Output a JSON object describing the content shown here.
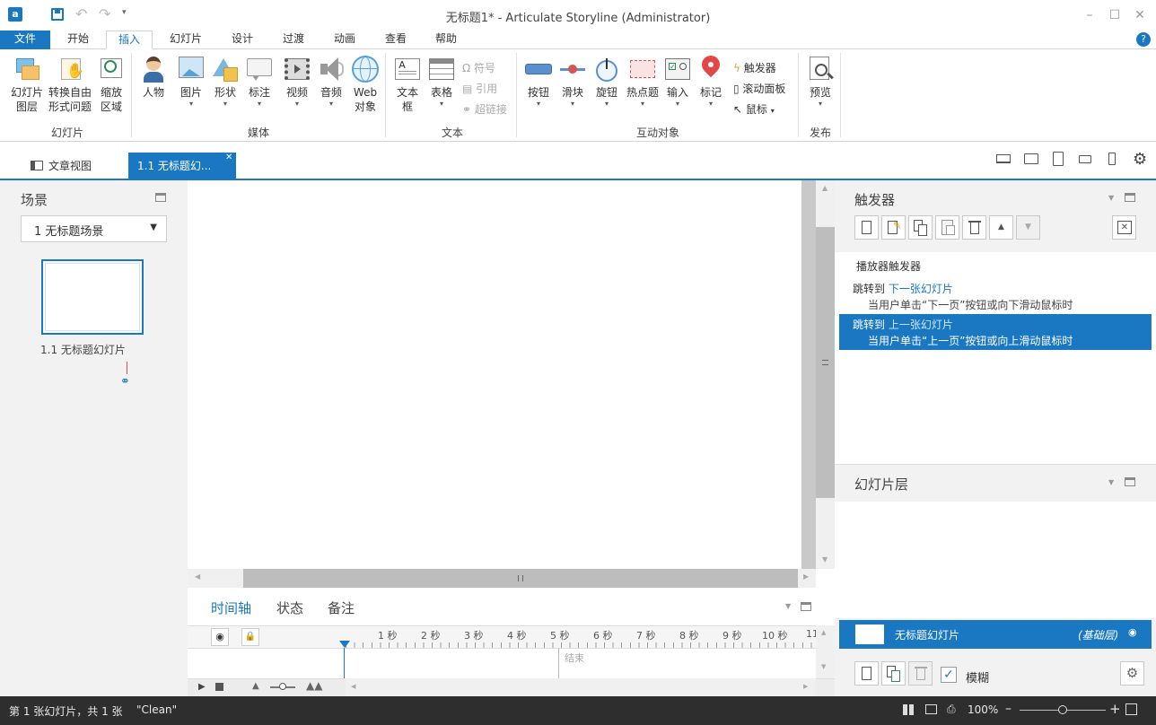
{
  "window": {
    "title": "无标题1* -  Articulate Storyline (Administrator)"
  },
  "menu": {
    "tabs": [
      "文件",
      "开始",
      "插入",
      "幻灯片",
      "设计",
      "过渡",
      "动画",
      "查看",
      "帮助"
    ],
    "active": "插入"
  },
  "ribbon": {
    "groups": {
      "slide": {
        "label": "幻灯片",
        "btn1": "幻灯片\n图层",
        "btn1_l1": "幻灯片",
        "btn1_l2": "图层",
        "btn2_l1": "转换自由",
        "btn2_l2": "形式问题",
        "btn3_l1": "缩放",
        "btn3_l2": "区域"
      },
      "media": {
        "label": "媒体",
        "character": "人物",
        "picture": "图片",
        "shape": "形状",
        "callout": "标注",
        "video": "视频",
        "audio": "音频",
        "web_l1": "Web",
        "web_l2": "对象"
      },
      "text": {
        "label": "文本",
        "textbox_l1": "文本",
        "textbox_l2": "框",
        "table": "表格",
        "symbol": "符号",
        "reference": "引用",
        "hyperlink": "超链接"
      },
      "interactive": {
        "label": "互动对象",
        "button": "按钮",
        "slider": "滑块",
        "dial": "旋钮",
        "hotspot": "热点题",
        "input": "输入",
        "marker": "标记",
        "trigger": "触发器",
        "scroll_panel": "滚动面板",
        "mouse": "鼠标"
      },
      "publish": {
        "label": "发布",
        "preview": "预览"
      }
    }
  },
  "doc_tabs": {
    "story_view": "文章视图",
    "slide_tab": "1.1 无标题幻..."
  },
  "scenes": {
    "title": "场景",
    "selected_scene": "1 无标题场景",
    "slide_label": "1.1 无标题幻灯片"
  },
  "timeline": {
    "tabs": [
      "时间轴",
      "状态",
      "备注"
    ],
    "ticks": [
      "1 秒",
      "2 秒",
      "3 秒",
      "4 秒",
      "5 秒",
      "6 秒",
      "7 秒",
      "8 秒",
      "9 秒",
      "10 秒",
      "11"
    ],
    "end_label": "结束"
  },
  "triggers": {
    "title": "触发器",
    "player_header": "播放器触发器",
    "items": [
      {
        "action": "跳转到",
        "target": "下一张幻灯片",
        "condition": "当用户单击“下一页”按钮或向下滑动鼠标时",
        "selected": false
      },
      {
        "action": "跳转到",
        "target": "上一张幻灯片",
        "condition": "当用户单击“上一页”按钮或向上滑动鼠标时",
        "selected": true
      }
    ]
  },
  "layers": {
    "title": "幻灯片层",
    "base_layer_name": "无标题幻灯片",
    "base_layer_tag": "(基础层)",
    "dim_label": "模糊",
    "dim_checked": true
  },
  "status": {
    "slide_info": "第 1 张幻灯片，共 1 张",
    "theme": "\"Clean\"",
    "zoom": "100%"
  },
  "colors": {
    "accent": "#1a78c2",
    "statusbar": "#2e2e2e"
  }
}
